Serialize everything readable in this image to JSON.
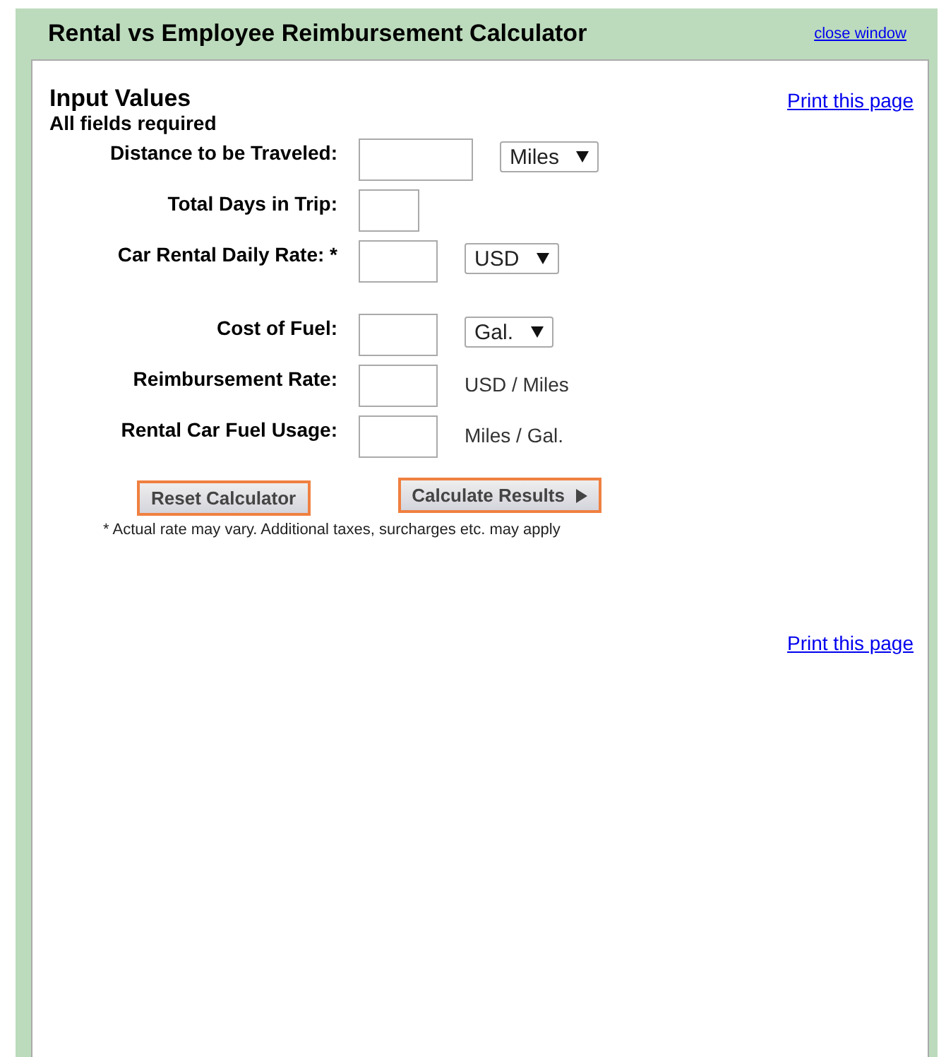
{
  "window": {
    "title": "Rental vs Employee Reimbursement Calculator",
    "close_link": "close window"
  },
  "form": {
    "heading": "Input Values",
    "subheading": "All fields required",
    "print_link": "Print this page",
    "rows": [
      {
        "label": "Distance to be Traveled:",
        "kind": "select",
        "unit": "Miles"
      },
      {
        "label": "Total Days in Trip:",
        "kind": "none"
      },
      {
        "label": "Car Rental Daily Rate: *",
        "kind": "select",
        "unit": "USD"
      },
      {
        "label": "Cost of Fuel:",
        "kind": "select",
        "unit": "Gal."
      },
      {
        "label": "Reimbursement Rate:",
        "kind": "unit",
        "unit": "USD / Miles"
      },
      {
        "label": "Rental Car Fuel Usage:",
        "kind": "unit",
        "unit": "Miles / Gal."
      }
    ],
    "buttons": [
      "Reset Calculator",
      "Calculate Results"
    ],
    "footnote": "* Actual rate may vary. Additional taxes, surcharges etc. may apply",
    "bottom_print_link": "Print this page"
  }
}
